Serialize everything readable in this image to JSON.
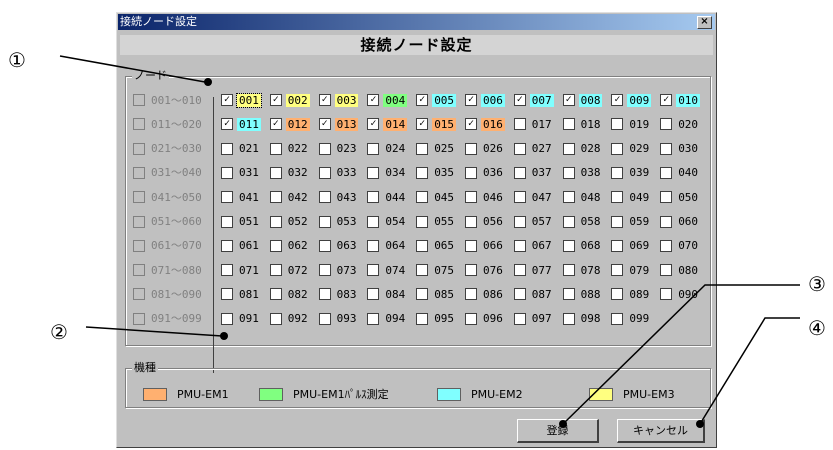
{
  "window": {
    "title": "接続ノード設定",
    "close_label": "×"
  },
  "header": "接続ノード設定",
  "node_group": {
    "legend": "ノード"
  },
  "range_labels": [
    "001～010",
    "011～020",
    "021～030",
    "031～040",
    "041～050",
    "051～060",
    "061～070",
    "071～080",
    "081～090",
    "091～099"
  ],
  "nodes": [
    [
      "001",
      "002",
      "003",
      "004",
      "005",
      "006",
      "007",
      "008",
      "009",
      "010"
    ],
    [
      "011",
      "012",
      "013",
      "014",
      "015",
      "016",
      "017",
      "018",
      "019",
      "020"
    ],
    [
      "021",
      "022",
      "023",
      "024",
      "025",
      "026",
      "027",
      "028",
      "029",
      "030"
    ],
    [
      "031",
      "032",
      "033",
      "034",
      "035",
      "036",
      "037",
      "038",
      "039",
      "040"
    ],
    [
      "041",
      "042",
      "043",
      "044",
      "045",
      "046",
      "047",
      "048",
      "049",
      "050"
    ],
    [
      "051",
      "052",
      "053",
      "054",
      "055",
      "056",
      "057",
      "058",
      "059",
      "060"
    ],
    [
      "061",
      "062",
      "063",
      "064",
      "065",
      "066",
      "067",
      "068",
      "069",
      "070"
    ],
    [
      "071",
      "072",
      "073",
      "074",
      "075",
      "076",
      "077",
      "078",
      "079",
      "080"
    ],
    [
      "081",
      "082",
      "083",
      "084",
      "085",
      "086",
      "087",
      "088",
      "089",
      "090"
    ],
    [
      "091",
      "092",
      "093",
      "094",
      "095",
      "096",
      "097",
      "098",
      "099"
    ]
  ],
  "checked_nodes": [
    "001",
    "002",
    "003",
    "004",
    "005",
    "006",
    "007",
    "008",
    "009",
    "010",
    "011",
    "012",
    "013",
    "014",
    "015",
    "016"
  ],
  "node_colors": {
    "001": "#ffff80",
    "002": "#ffff80",
    "003": "#ffff80",
    "004": "#80ff80",
    "005": "#80ffff",
    "006": "#80ffff",
    "007": "#80ffff",
    "008": "#80ffff",
    "009": "#80ffff",
    "010": "#80ffff",
    "011": "#80ffff",
    "012": "#ffb070",
    "013": "#ffb070",
    "014": "#ffb070",
    "015": "#ffb070",
    "016": "#ffb070"
  },
  "model_group": {
    "legend": "機種",
    "items": [
      {
        "color": "#ffb070",
        "label": "PMU-EM1"
      },
      {
        "color": "#80ff80",
        "label": "PMU-EM1ﾊﾟﾙｽ測定"
      },
      {
        "color": "#80ffff",
        "label": "PMU-EM2"
      },
      {
        "color": "#ffff80",
        "label": "PMU-EM3"
      }
    ]
  },
  "buttons": {
    "register": "登録",
    "cancel": "キャンセル"
  },
  "annotations": [
    "①",
    "②",
    "③",
    "④"
  ]
}
